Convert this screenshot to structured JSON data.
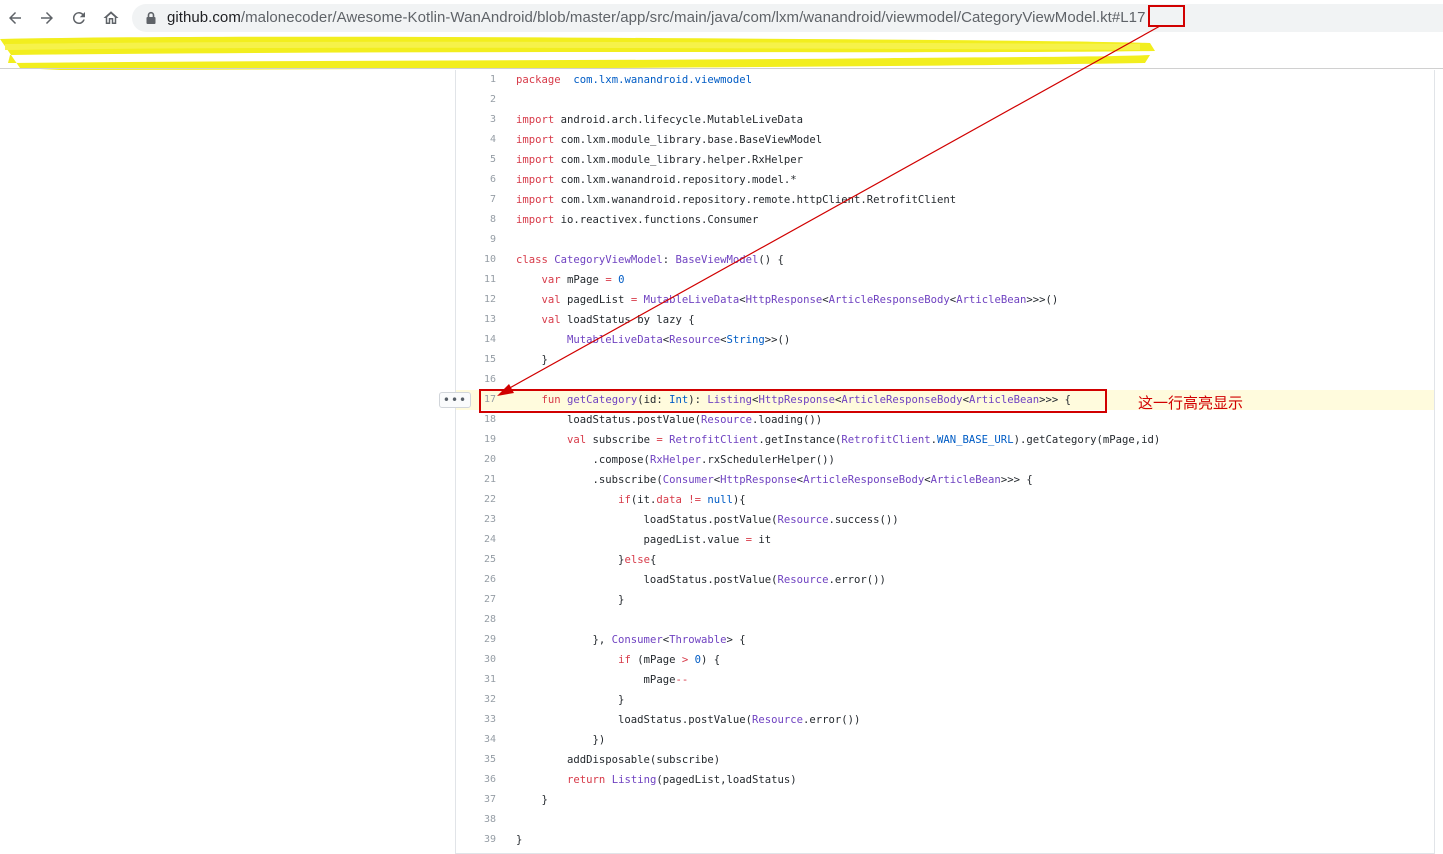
{
  "browser": {
    "back_label": "Back",
    "forward_label": "Forward",
    "reload_label": "Reload",
    "home_label": "Home",
    "url_host": "github.com",
    "url_path": "/malonecoder/Awesome-Kotlin-WanAndroid/blob/master/app/src/main/java/com/lxm/wanandroid/viewmodel/CategoryViewModel.kt",
    "url_hash": "#L17"
  },
  "code": {
    "highlighted_line": 17,
    "options_button_label": "•••",
    "lines": [
      {
        "n": "1"
      },
      {
        "n": "2"
      },
      {
        "n": "3"
      },
      {
        "n": "4"
      },
      {
        "n": "5"
      },
      {
        "n": "6"
      },
      {
        "n": "7"
      },
      {
        "n": "8"
      },
      {
        "n": "9"
      },
      {
        "n": "10"
      },
      {
        "n": "11"
      },
      {
        "n": "12"
      },
      {
        "n": "13"
      },
      {
        "n": "14"
      },
      {
        "n": "15"
      },
      {
        "n": "16"
      },
      {
        "n": "17"
      },
      {
        "n": "18"
      },
      {
        "n": "19"
      },
      {
        "n": "20"
      },
      {
        "n": "21"
      },
      {
        "n": "22"
      },
      {
        "n": "23"
      },
      {
        "n": "24"
      },
      {
        "n": "25"
      },
      {
        "n": "26"
      },
      {
        "n": "27"
      },
      {
        "n": "28"
      },
      {
        "n": "29"
      },
      {
        "n": "30"
      },
      {
        "n": "31"
      },
      {
        "n": "32"
      },
      {
        "n": "33"
      },
      {
        "n": "34"
      },
      {
        "n": "35"
      },
      {
        "n": "36"
      },
      {
        "n": "37"
      },
      {
        "n": "38"
      },
      {
        "n": "39"
      }
    ],
    "tokens": [
      [
        [
          "kw",
          "package"
        ],
        [
          "",
          "  "
        ],
        [
          "cn",
          "com.lxm.wanandroid.viewmodel"
        ]
      ],
      [],
      [
        [
          "kw",
          "import"
        ],
        [
          "",
          " android.arch.lifecycle.MutableLiveData"
        ]
      ],
      [
        [
          "kw",
          "import"
        ],
        [
          "",
          " com.lxm.module_library.base.BaseViewModel"
        ]
      ],
      [
        [
          "kw",
          "import"
        ],
        [
          "",
          " com.lxm.module_library.helper.RxHelper"
        ]
      ],
      [
        [
          "kw",
          "import"
        ],
        [
          "",
          " com.lxm.wanandroid.repository.model.*"
        ]
      ],
      [
        [
          "kw",
          "import"
        ],
        [
          "",
          " com.lxm.wanandroid.repository.remote.httpClient.RetrofitClient"
        ]
      ],
      [
        [
          "kw",
          "import"
        ],
        [
          "",
          " io.reactivex.functions.Consumer"
        ]
      ],
      [],
      [
        [
          "kw",
          "class"
        ],
        [
          "",
          " "
        ],
        [
          "ty",
          "CategoryViewModel"
        ],
        [
          "",
          ": "
        ],
        [
          "ty",
          "BaseViewModel"
        ],
        [
          "",
          "() {"
        ]
      ],
      [
        [
          "",
          "    "
        ],
        [
          "kw",
          "var"
        ],
        [
          "",
          " mPage "
        ],
        [
          "kw",
          "="
        ],
        [
          "",
          " "
        ],
        [
          "cn",
          "0"
        ]
      ],
      [
        [
          "",
          "    "
        ],
        [
          "kw",
          "val"
        ],
        [
          "",
          " pagedList "
        ],
        [
          "kw",
          "="
        ],
        [
          "",
          " "
        ],
        [
          "ty",
          "MutableLiveData"
        ],
        [
          "",
          "<"
        ],
        [
          "ty",
          "HttpResponse"
        ],
        [
          "",
          "<"
        ],
        [
          "ty",
          "ArticleResponseBody"
        ],
        [
          "",
          "<"
        ],
        [
          "ty",
          "ArticleBean"
        ],
        [
          "",
          ">>>()"
        ]
      ],
      [
        [
          "",
          "    "
        ],
        [
          "kw",
          "val"
        ],
        [
          "",
          " loadStatus by lazy {"
        ]
      ],
      [
        [
          "",
          "        "
        ],
        [
          "ty",
          "MutableLiveData"
        ],
        [
          "",
          "<"
        ],
        [
          "ty",
          "Resource"
        ],
        [
          "",
          "<"
        ],
        [
          "cn",
          "String"
        ],
        [
          "",
          ">>()"
        ]
      ],
      [
        [
          "",
          "    }"
        ]
      ],
      [],
      [
        [
          "",
          "    "
        ],
        [
          "kw",
          "fun"
        ],
        [
          "",
          " "
        ],
        [
          "fn",
          "getCategory"
        ],
        [
          "",
          "(id: "
        ],
        [
          "cn",
          "Int"
        ],
        [
          "",
          "): "
        ],
        [
          "ty",
          "Listing"
        ],
        [
          "",
          "<"
        ],
        [
          "ty",
          "HttpResponse"
        ],
        [
          "",
          "<"
        ],
        [
          "ty",
          "ArticleResponseBody"
        ],
        [
          "",
          "<"
        ],
        [
          "ty",
          "ArticleBean"
        ],
        [
          "",
          ">>> {"
        ]
      ],
      [
        [
          "",
          "        loadStatus.postValue("
        ],
        [
          "ty",
          "Resource"
        ],
        [
          "",
          ".loading())"
        ]
      ],
      [
        [
          "",
          "        "
        ],
        [
          "kw",
          "val"
        ],
        [
          "",
          " subscribe "
        ],
        [
          "kw",
          "="
        ],
        [
          "",
          " "
        ],
        [
          "ty",
          "RetrofitClient"
        ],
        [
          "",
          ".getInstance("
        ],
        [
          "ty",
          "RetrofitClient"
        ],
        [
          "",
          "."
        ],
        [
          "cn",
          "WAN_BASE_URL"
        ],
        [
          "",
          ").getCategory(mPage,id)"
        ]
      ],
      [
        [
          "",
          "            .compose("
        ],
        [
          "ty",
          "RxHelper"
        ],
        [
          "",
          ".rxSchedulerHelper())"
        ]
      ],
      [
        [
          "",
          "            .subscribe("
        ],
        [
          "ty",
          "Consumer"
        ],
        [
          "",
          "<"
        ],
        [
          "ty",
          "HttpResponse"
        ],
        [
          "",
          "<"
        ],
        [
          "ty",
          "ArticleResponseBody"
        ],
        [
          "",
          "<"
        ],
        [
          "ty",
          "ArticleBean"
        ],
        [
          "",
          ">>> {"
        ]
      ],
      [
        [
          "",
          "                "
        ],
        [
          "kw",
          "if"
        ],
        [
          "",
          "(it."
        ],
        [
          "kw",
          "data"
        ],
        [
          "",
          " "
        ],
        [
          "kw",
          "!="
        ],
        [
          "",
          " "
        ],
        [
          "cn",
          "null"
        ],
        [
          "",
          "){"
        ]
      ],
      [
        [
          "",
          "                    loadStatus.postValue("
        ],
        [
          "ty",
          "Resource"
        ],
        [
          "",
          ".success())"
        ]
      ],
      [
        [
          "",
          "                    pagedList.value "
        ],
        [
          "kw",
          "="
        ],
        [
          "",
          " it"
        ]
      ],
      [
        [
          "",
          "                }"
        ],
        [
          "kw",
          "else"
        ],
        [
          "",
          "{"
        ]
      ],
      [
        [
          "",
          "                    loadStatus.postValue("
        ],
        [
          "ty",
          "Resource"
        ],
        [
          "",
          ".error())"
        ]
      ],
      [
        [
          "",
          "                }"
        ]
      ],
      [],
      [
        [
          "",
          "            }, "
        ],
        [
          "ty",
          "Consumer"
        ],
        [
          "",
          "<"
        ],
        [
          "ty",
          "Throwable"
        ],
        [
          "",
          "> {"
        ]
      ],
      [
        [
          "",
          "                "
        ],
        [
          "kw",
          "if"
        ],
        [
          "",
          " (mPage "
        ],
        [
          "kw",
          ">"
        ],
        [
          "",
          " "
        ],
        [
          "cn",
          "0"
        ],
        [
          "",
          ") {"
        ]
      ],
      [
        [
          "",
          "                    mPage"
        ],
        [
          "kw",
          "--"
        ]
      ],
      [
        [
          "",
          "                }"
        ]
      ],
      [
        [
          "",
          "                loadStatus.postValue("
        ],
        [
          "ty",
          "Resource"
        ],
        [
          "",
          ".error())"
        ]
      ],
      [
        [
          "",
          "            })"
        ]
      ],
      [
        [
          "",
          "        addDisposable(subscribe)"
        ]
      ],
      [
        [
          "",
          "        "
        ],
        [
          "kw",
          "return"
        ],
        [
          "",
          " "
        ],
        [
          "ty",
          "Listing"
        ],
        [
          "",
          "(pagedList,loadStatus)"
        ]
      ],
      [
        [
          "",
          "    }"
        ]
      ],
      [],
      [
        [
          "",
          "}"
        ]
      ]
    ]
  },
  "annotation": {
    "note": "这一行高亮显示",
    "color": "#d10000"
  },
  "colors": {
    "keyword": "#d73a49",
    "type": "#6f42c1",
    "constant": "#005cc5",
    "highlight": "#fffbdd",
    "scribble": "#f2ee1e"
  }
}
